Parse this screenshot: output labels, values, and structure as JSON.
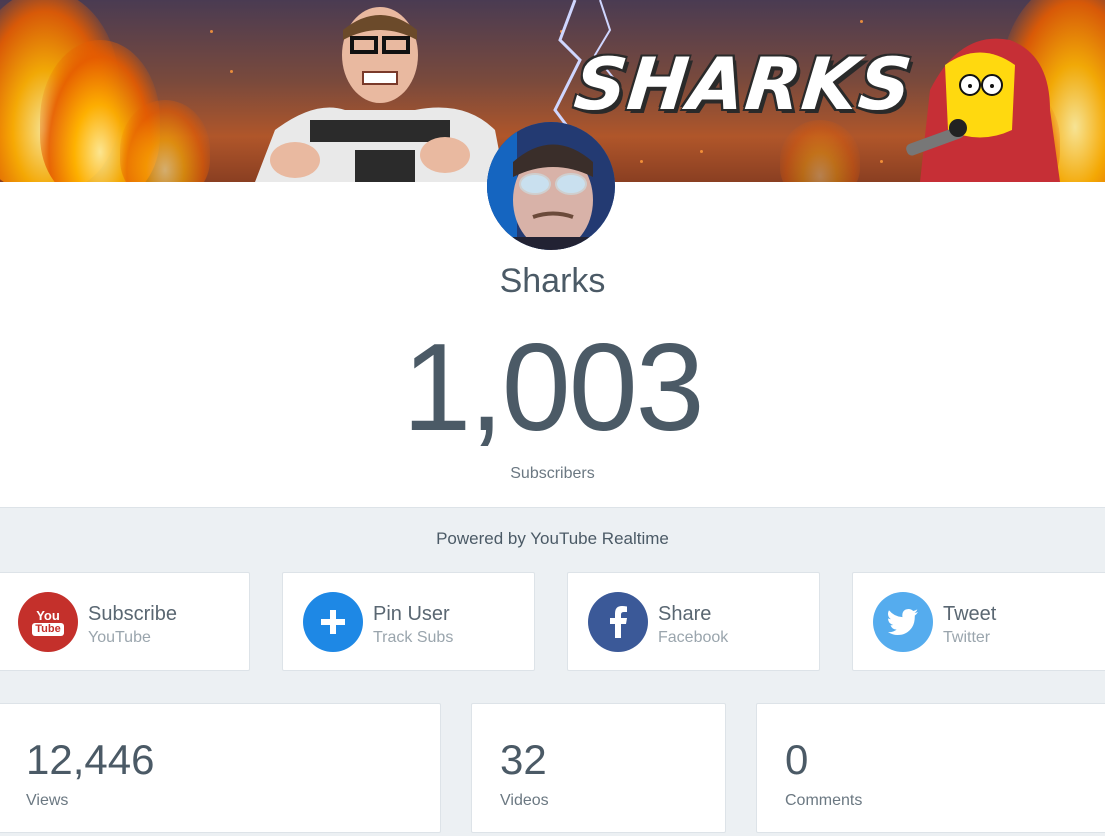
{
  "banner": {
    "title": "SHARKS"
  },
  "channel": {
    "name": "Sharks",
    "subscriber_count": "1,003",
    "subscriber_label": "Subscribers"
  },
  "powered_by": "Powered by YouTube Realtime",
  "actions": [
    {
      "title": "Subscribe",
      "subtitle": "YouTube",
      "icon": "youtube-icon",
      "color": "#c4302b"
    },
    {
      "title": "Pin User",
      "subtitle": "Track Subs",
      "icon": "plus-icon",
      "color": "#1e88e5"
    },
    {
      "title": "Share",
      "subtitle": "Facebook",
      "icon": "facebook-icon",
      "color": "#3b5998"
    },
    {
      "title": "Tweet",
      "subtitle": "Twitter",
      "icon": "twitter-icon",
      "color": "#55acee"
    }
  ],
  "stats": [
    {
      "value": "12,446",
      "label": "Views"
    },
    {
      "value": "32",
      "label": "Videos"
    },
    {
      "value": "0",
      "label": "Comments"
    }
  ],
  "youtube_logo": {
    "top": "You",
    "bottom": "Tube"
  }
}
